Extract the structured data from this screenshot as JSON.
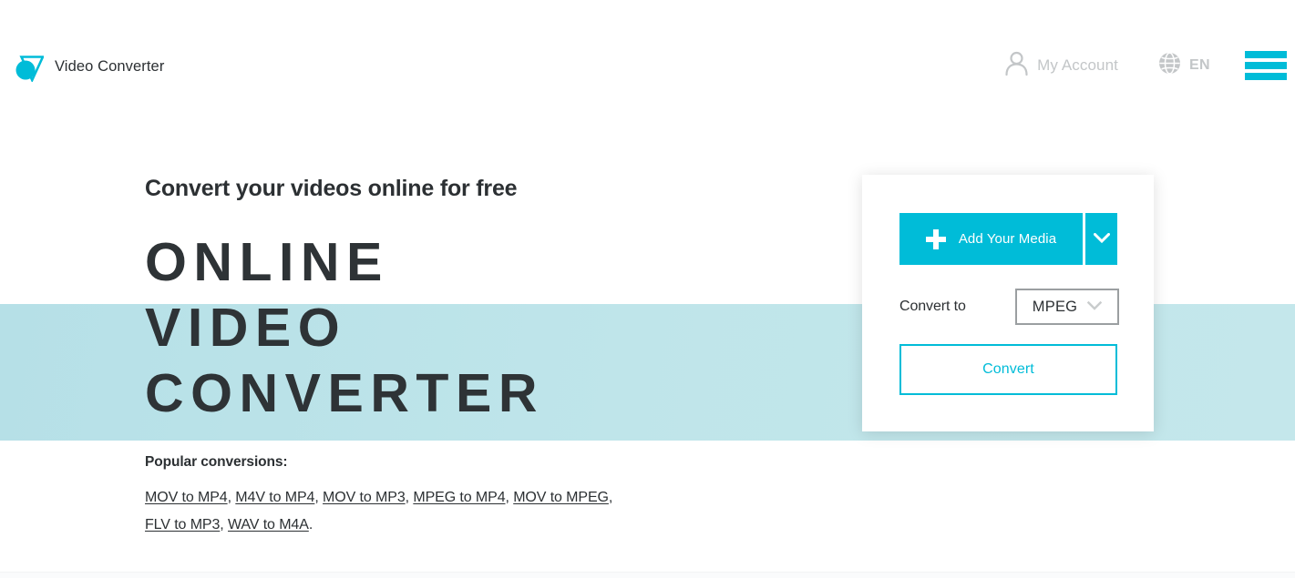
{
  "header": {
    "brand_name": "Video Converter",
    "logo_icon": "video-converter-logo",
    "account": {
      "label": "My Account",
      "icon": "person-icon"
    },
    "language": {
      "label": "EN",
      "icon": "globe-icon"
    },
    "menu": {
      "icon": "hamburger-menu-icon"
    }
  },
  "hero": {
    "tagline": "Convert your videos online for free",
    "title_line_1": "ONLINE",
    "title_line_2": "VIDEO",
    "title_line_3": "CONVERTER"
  },
  "popular": {
    "heading": "Popular conversions:",
    "links": [
      "MOV to MP4",
      "M4V to MP4",
      "MOV to MP3",
      "MPEG to MP4",
      "MOV to MPEG",
      "FLV to MP3",
      "WAV to M4A"
    ],
    "separator": ", ",
    "terminator": "."
  },
  "card": {
    "add_media": {
      "label": "Add Your Media",
      "plus_icon": "plus-icon",
      "dropdown_icon": "chevron-down-icon"
    },
    "convert_to": {
      "label": "Convert to",
      "selected_value": "MPEG",
      "chevron_icon": "chevron-down-icon",
      "options": [
        "MPEG"
      ]
    },
    "convert_button_label": "Convert"
  },
  "colors": {
    "accent": "#00bcd8",
    "band": "#bce3e8",
    "text": "#2c3033",
    "muted": "#c3c6c8",
    "select_border": "#9b9fa1"
  }
}
